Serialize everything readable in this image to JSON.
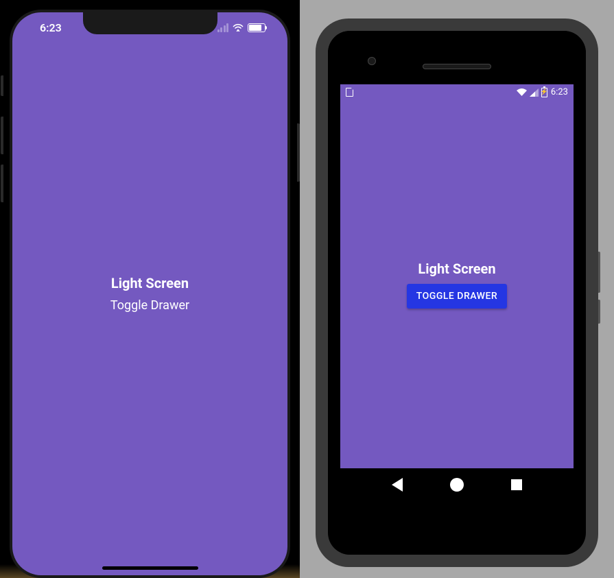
{
  "ios": {
    "statusbar": {
      "time": "6:23"
    },
    "title": "Light Screen",
    "toggle_label": "Toggle Drawer"
  },
  "android": {
    "statusbar": {
      "time": "6:23"
    },
    "title": "Light Screen",
    "toggle_label": "TOGGLE DRAWER"
  },
  "colors": {
    "app_background": "#7459C0",
    "android_button": "#2536E3"
  }
}
